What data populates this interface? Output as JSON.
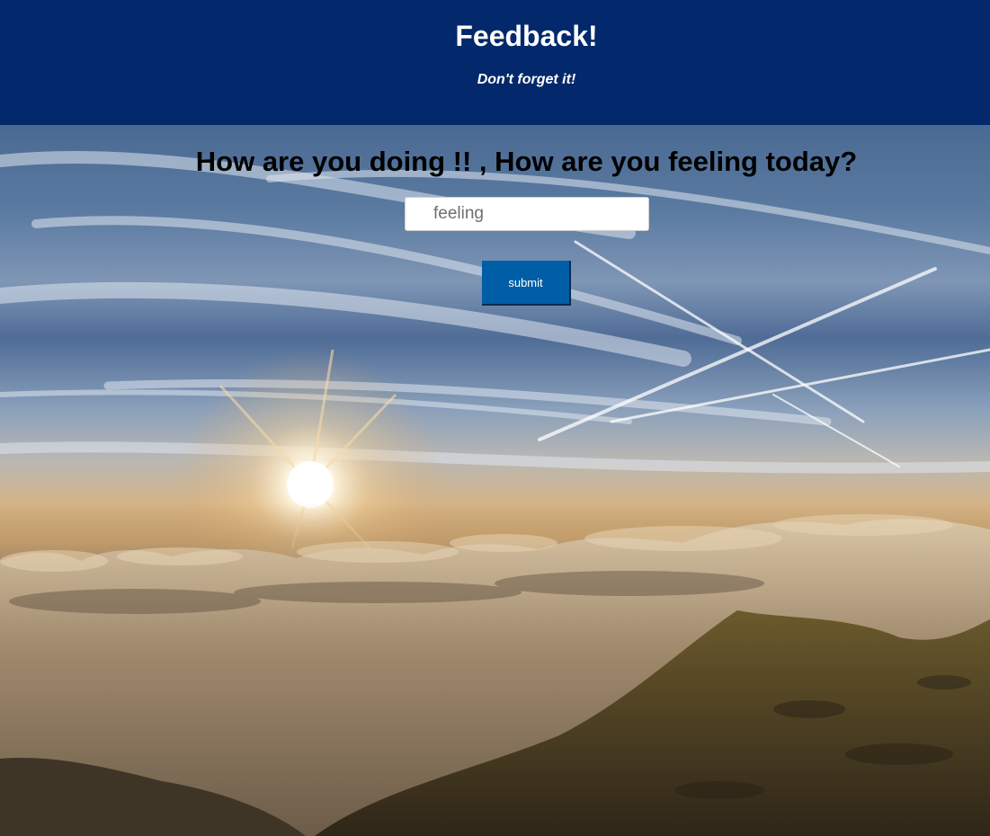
{
  "header": {
    "title": "Feedback!",
    "subtitle": "Don't forget it!"
  },
  "main": {
    "question": "How are you doing !! , How are you feeling today?",
    "feeling_input": {
      "placeholder": "feeling",
      "value": ""
    },
    "submit_label": "submit"
  },
  "colors": {
    "header_bg": "#03286b",
    "button_bg": "#005ea6"
  }
}
